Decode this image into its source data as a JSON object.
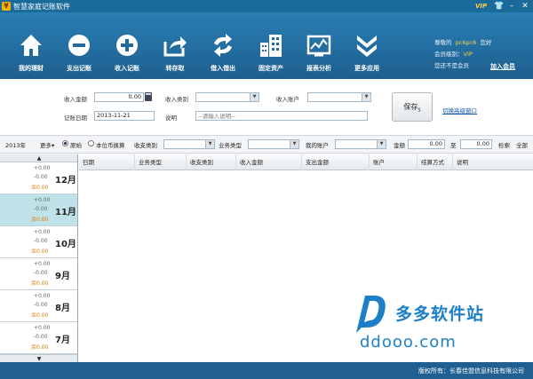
{
  "window": {
    "title": "智慧家庭记账软件",
    "app_icon_glyph": "¥",
    "vip_badge": "VIP",
    "controls": {
      "shirt": "👕",
      "minimize": "–",
      "close": "✕"
    }
  },
  "toolbar": {
    "items": [
      {
        "label": "我的理财",
        "icon": "home-icon"
      },
      {
        "label": "支出记账",
        "icon": "minus-circle-icon"
      },
      {
        "label": "收入记账",
        "icon": "plus-circle-icon"
      },
      {
        "label": "转存取",
        "icon": "transfer-icon"
      },
      {
        "label": "借入借出",
        "icon": "exchange-icon"
      },
      {
        "label": "固定资产",
        "icon": "building-icon"
      },
      {
        "label": "报表分析",
        "icon": "chart-icon"
      },
      {
        "label": "更多应用",
        "icon": "chevrons-down-icon"
      }
    ]
  },
  "user": {
    "greeting_prefix": "尊敬的",
    "username": "pc6pc6",
    "greeting_suffix": "您好",
    "level_label": "会员级别：",
    "level_value": "VIP",
    "status": "您还不是会员",
    "join_link": "加入会员"
  },
  "form": {
    "income_amount_label": "收入金额",
    "income_amount_value": "0.00",
    "income_type_label": "收入类别",
    "income_account_label": "收入账户",
    "date_label": "记账日期",
    "date_value": "2013-11-21",
    "note_label": "说明",
    "note_placeholder": "--请输入说明--",
    "save_button": "保存",
    "save_hotkey": "S",
    "switch_link": "切换高级窗口"
  },
  "filter": {
    "year": "2013年",
    "more": "更多▾",
    "radio_original": "原始",
    "radio_converted": "本位币换算",
    "income_expense_type_label": "收支类别",
    "business_type_label": "业务类型",
    "my_account_label": "我的账户",
    "amount_label": "金额",
    "amount_from": "0.00",
    "to_label": "至",
    "amount_to": "0.00",
    "search_label": "检索",
    "all_label": "全部"
  },
  "months": {
    "scroll_up": "▲",
    "scroll_down": "▼",
    "items": [
      {
        "name": "12月",
        "income": "+0.00",
        "expense": "-0.00",
        "balance": "余0.00"
      },
      {
        "name": "11月",
        "income": "+0.00",
        "expense": "-0.00",
        "balance": "余0.00"
      },
      {
        "name": "10月",
        "income": "+0.00",
        "expense": "-0.00",
        "balance": "余0.00"
      },
      {
        "name": "9月",
        "income": "+0.00",
        "expense": "-0.00",
        "balance": "余0.00"
      },
      {
        "name": "8月",
        "income": "+0.00",
        "expense": "-0.00",
        "balance": "余0.00"
      },
      {
        "name": "7月",
        "income": "+0.00",
        "expense": "-0.00",
        "balance": "余0.00"
      }
    ]
  },
  "grid": {
    "columns": [
      "日期",
      "业务类型",
      "收支类别",
      "收入金额",
      "支出金额",
      "账户",
      "结算方式",
      "说明"
    ]
  },
  "watermark": {
    "chinese": "多多软件站",
    "url": "ddooo.com"
  },
  "status": {
    "copyright": "版权所有：长春佳盟信息科技有限公司"
  },
  "colors": {
    "toolbar_blue": "#2a7fb5",
    "statusbar_blue": "#1f5f92",
    "active_month": "#bfe2e8",
    "balance_orange": "#e07a00",
    "link_blue": "#1454b0",
    "vip_gold": "#ffd23f"
  }
}
